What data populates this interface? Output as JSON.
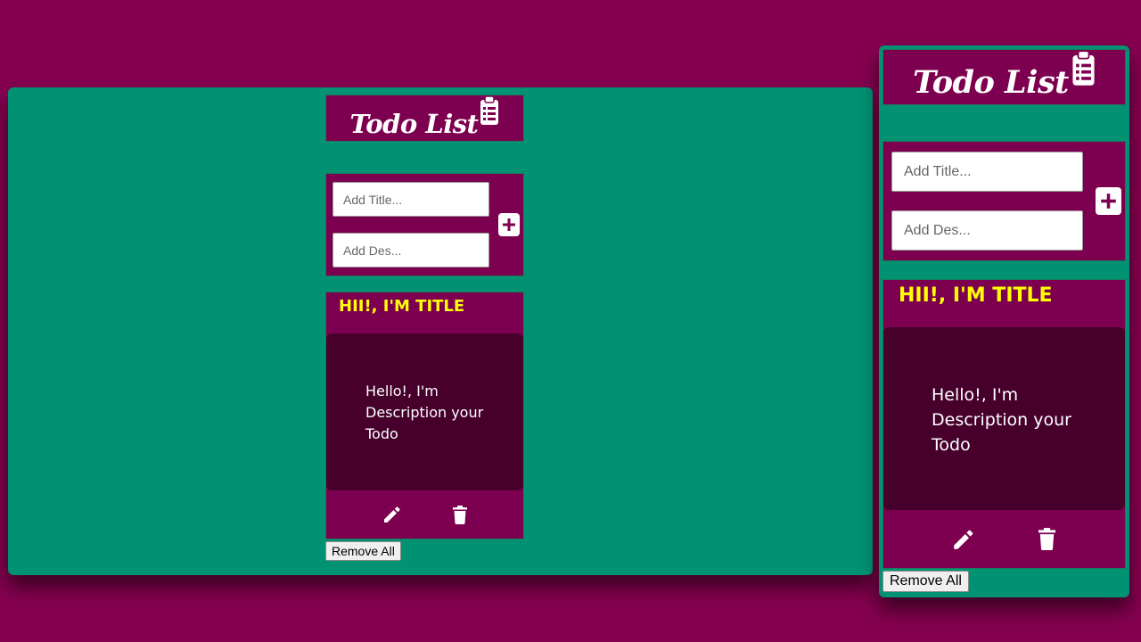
{
  "app": {
    "title": "Todo List",
    "title_placeholder": "Add Title...",
    "description_placeholder": "Add Des...",
    "remove_all_label": "Remove All"
  },
  "todo": {
    "title": "HII!, I'M TITLE",
    "description": "Hello!, I'm Description your Todo"
  },
  "icons": {
    "header": "clipboard-list-icon",
    "add": "plus-square-icon",
    "edit": "pencil-icon",
    "delete": "trash-icon"
  },
  "colors": {
    "background": "#85004f",
    "frame": "#009273",
    "panel": "#7d0050",
    "card_body": "#46002b",
    "todo_title": "#ffff00"
  }
}
